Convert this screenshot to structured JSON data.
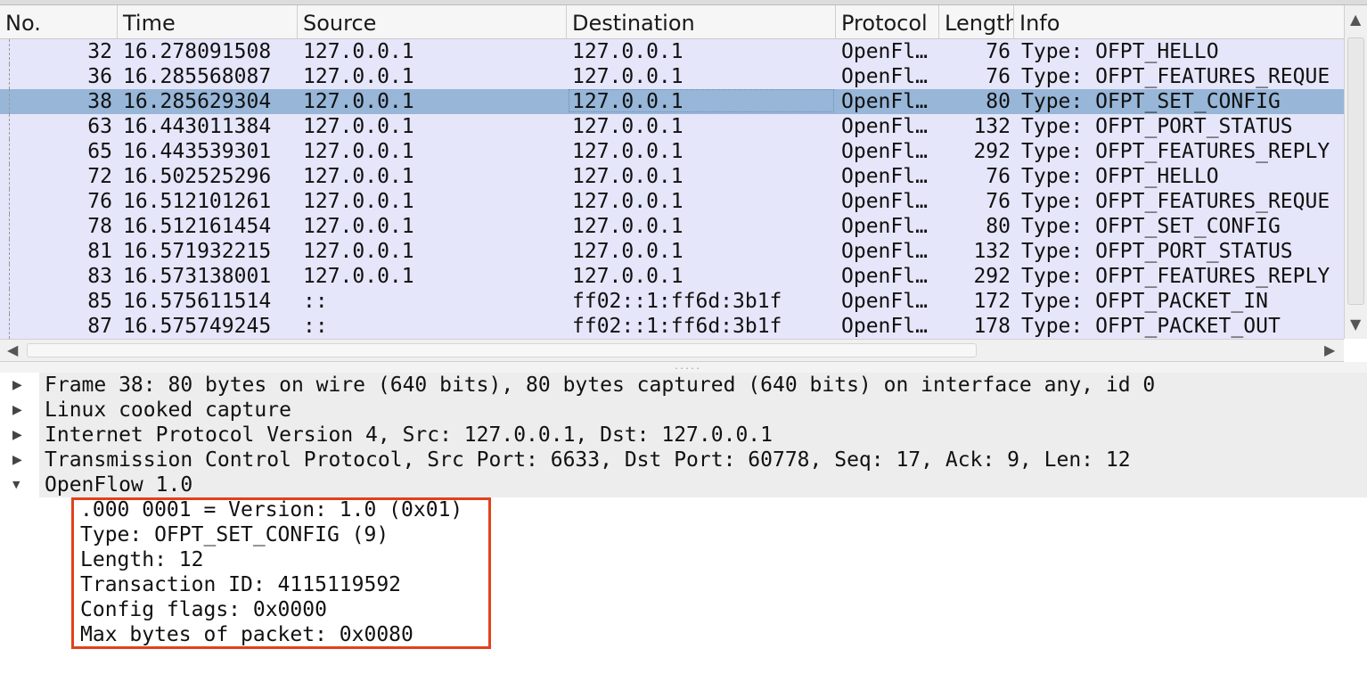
{
  "columns": [
    "No.",
    "Time",
    "Source",
    "Destination",
    "Protocol",
    "Length",
    "Info"
  ],
  "packets": [
    {
      "no": "32",
      "time": "16.278091508",
      "source": "127.0.0.1",
      "destination": "127.0.0.1",
      "protocol": "OpenFl…",
      "length": "76",
      "info": "Type: OFPT_HELLO"
    },
    {
      "no": "36",
      "time": "16.285568087",
      "source": "127.0.0.1",
      "destination": "127.0.0.1",
      "protocol": "OpenFl…",
      "length": "76",
      "info": "Type: OFPT_FEATURES_REQUE"
    },
    {
      "no": "38",
      "time": "16.285629304",
      "source": "127.0.0.1",
      "destination": "127.0.0.1",
      "protocol": "OpenFl…",
      "length": "80",
      "info": "Type: OFPT_SET_CONFIG"
    },
    {
      "no": "63",
      "time": "16.443011384",
      "source": "127.0.0.1",
      "destination": "127.0.0.1",
      "protocol": "OpenFl…",
      "length": "132",
      "info": "Type: OFPT_PORT_STATUS"
    },
    {
      "no": "65",
      "time": "16.443539301",
      "source": "127.0.0.1",
      "destination": "127.0.0.1",
      "protocol": "OpenFl…",
      "length": "292",
      "info": "Type: OFPT_FEATURES_REPLY"
    },
    {
      "no": "72",
      "time": "16.502525296",
      "source": "127.0.0.1",
      "destination": "127.0.0.1",
      "protocol": "OpenFl…",
      "length": "76",
      "info": "Type: OFPT_HELLO"
    },
    {
      "no": "76",
      "time": "16.512101261",
      "source": "127.0.0.1",
      "destination": "127.0.0.1",
      "protocol": "OpenFl…",
      "length": "76",
      "info": "Type: OFPT_FEATURES_REQUE"
    },
    {
      "no": "78",
      "time": "16.512161454",
      "source": "127.0.0.1",
      "destination": "127.0.0.1",
      "protocol": "OpenFl…",
      "length": "80",
      "info": "Type: OFPT_SET_CONFIG"
    },
    {
      "no": "81",
      "time": "16.571932215",
      "source": "127.0.0.1",
      "destination": "127.0.0.1",
      "protocol": "OpenFl…",
      "length": "132",
      "info": "Type: OFPT_PORT_STATUS"
    },
    {
      "no": "83",
      "time": "16.573138001",
      "source": "127.0.0.1",
      "destination": "127.0.0.1",
      "protocol": "OpenFl…",
      "length": "292",
      "info": "Type: OFPT_FEATURES_REPLY"
    },
    {
      "no": "85",
      "time": "16.575611514",
      "source": "::",
      "destination": "ff02::1:ff6d:3b1f",
      "protocol": "OpenFl…",
      "length": "172",
      "info": "Type: OFPT_PACKET_IN"
    },
    {
      "no": "87",
      "time": "16.575749245",
      "source": "::",
      "destination": "ff02::1:ff6d:3b1f",
      "protocol": "OpenFl…",
      "length": "178",
      "info": "Type: OFPT_PACKET_OUT"
    }
  ],
  "selected_packet_index": 2,
  "details": [
    {
      "text": "Frame 38: 80 bytes on wire (640 bits), 80 bytes captured (640 bits) on interface any, id 0",
      "expanded": false
    },
    {
      "text": "Linux cooked capture",
      "expanded": false
    },
    {
      "text": "Internet Protocol Version 4, Src: 127.0.0.1, Dst: 127.0.0.1",
      "expanded": false
    },
    {
      "text": "Transmission Control Protocol, Src Port: 6633, Dst Port: 60778, Seq: 17, Ack: 9, Len: 12",
      "expanded": false
    },
    {
      "text": "OpenFlow 1.0",
      "expanded": true
    }
  ],
  "openflow_fields": [
    ".000 0001 = Version: 1.0 (0x01)",
    "Type: OFPT_SET_CONFIG (9)",
    "Length: 12",
    "Transaction ID: 4115119592",
    "Config flags: 0x0000",
    "Max bytes of packet: 0x0080"
  ],
  "icons": {
    "collapsed": "▶",
    "expanded": "▼",
    "scroll_up": "▲",
    "scroll_down": "▼",
    "scroll_left": "◀",
    "scroll_right": "▶"
  },
  "colors": {
    "row_background": "#e6e6fa",
    "selected_row": "#97b6d8",
    "highlight_box": "#e2411b"
  }
}
